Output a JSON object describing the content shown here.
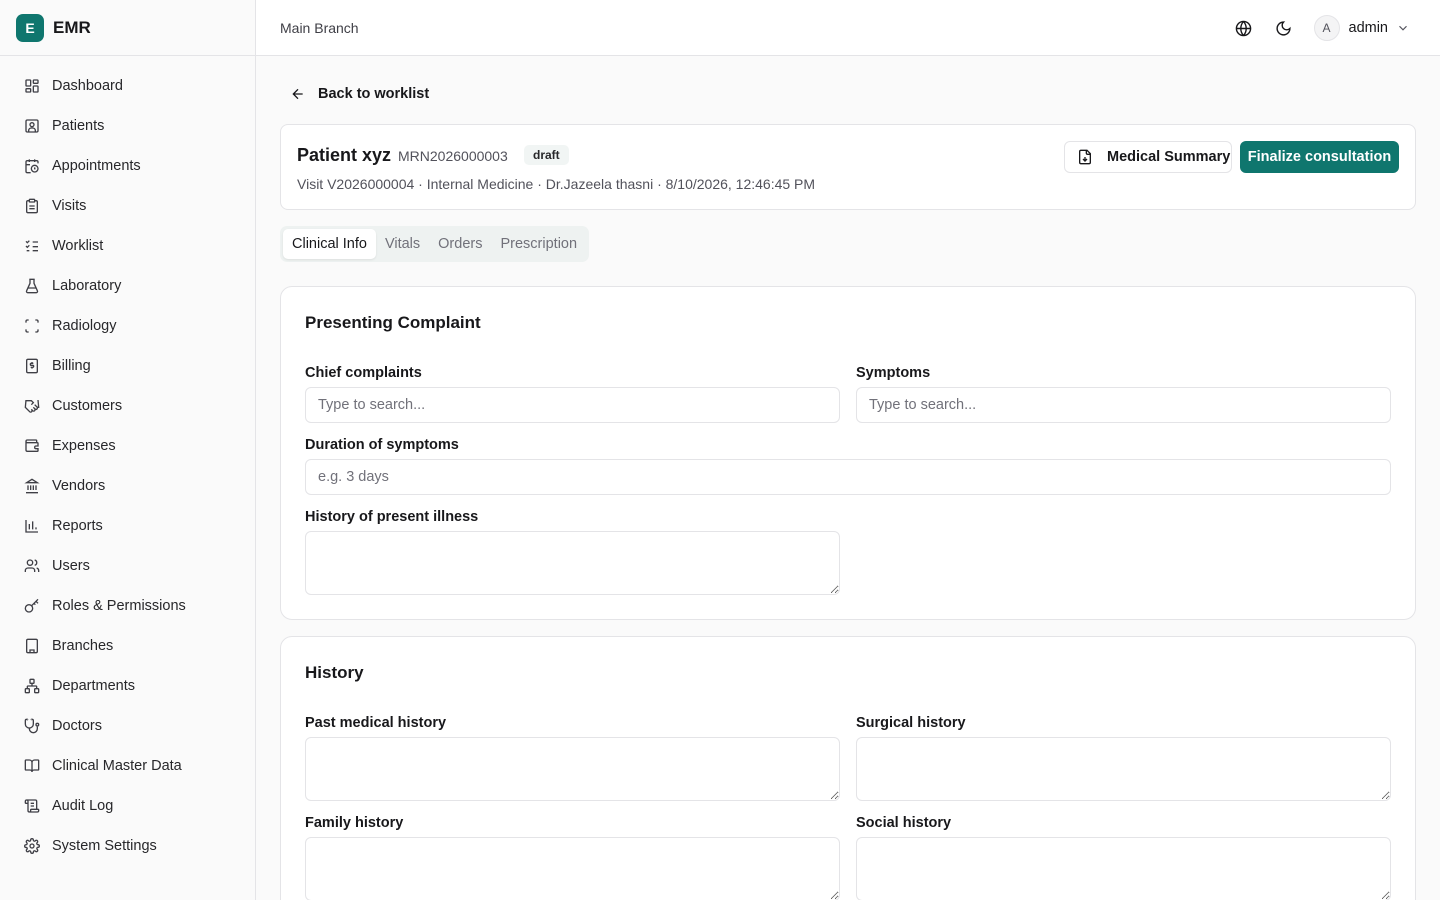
{
  "app": {
    "badge": "E",
    "name": "EMR"
  },
  "sidebar": {
    "items": [
      {
        "label": "Dashboard",
        "icon": "dashboard-icon"
      },
      {
        "label": "Patients",
        "icon": "patient-icon"
      },
      {
        "label": "Appointments",
        "icon": "calendar-clock-icon"
      },
      {
        "label": "Visits",
        "icon": "clipboard-icon"
      },
      {
        "label": "Worklist",
        "icon": "list-checks-icon"
      },
      {
        "label": "Laboratory",
        "icon": "flask-icon"
      },
      {
        "label": "Radiology",
        "icon": "scan-icon"
      },
      {
        "label": "Billing",
        "icon": "receipt-icon"
      },
      {
        "label": "Customers",
        "icon": "handshake-icon"
      },
      {
        "label": "Expenses",
        "icon": "wallet-icon"
      },
      {
        "label": "Vendors",
        "icon": "bank-icon"
      },
      {
        "label": "Reports",
        "icon": "bar-chart-icon"
      },
      {
        "label": "Users",
        "icon": "users-icon"
      },
      {
        "label": "Roles & Permissions",
        "icon": "key-icon"
      },
      {
        "label": "Branches",
        "icon": "building-icon"
      },
      {
        "label": "Departments",
        "icon": "network-icon"
      },
      {
        "label": "Doctors",
        "icon": "stethoscope-icon"
      },
      {
        "label": "Clinical Master Data",
        "icon": "book-icon"
      },
      {
        "label": "Audit Log",
        "icon": "scroll-icon"
      },
      {
        "label": "System Settings",
        "icon": "gear-icon"
      }
    ]
  },
  "header": {
    "branch": "Main Branch",
    "user_initial": "A",
    "user_name": "admin"
  },
  "main": {
    "back_label": "Back to worklist",
    "patient": {
      "name": "Patient xyz",
      "mrn": "MRN2026000003",
      "status": "draft",
      "visit_line": "Visit V2026000004 · Internal Medicine · Dr.Jazeela thasni · 8/10/2026, 12:46:45 PM"
    },
    "medical_summary_label": "Medical Summary",
    "finalize_label": "Finalize consultation",
    "tabs": [
      {
        "label": "Clinical Info",
        "active": true
      },
      {
        "label": "Vitals",
        "active": false
      },
      {
        "label": "Orders",
        "active": false
      },
      {
        "label": "Prescription",
        "active": false
      }
    ],
    "presenting": {
      "title": "Presenting Complaint",
      "chief_label": "Chief complaints",
      "chief_placeholder": "Type to search...",
      "symptoms_label": "Symptoms",
      "symptoms_placeholder": "Type to search...",
      "duration_label": "Duration of symptoms",
      "duration_placeholder": "e.g. 3 days",
      "hpi_label": "History of present illness"
    },
    "history": {
      "title": "History",
      "past_label": "Past medical history",
      "surgical_label": "Surgical history",
      "family_label": "Family history",
      "social_label": "Social history"
    }
  },
  "colors": {
    "accent": "#0f766e",
    "border": "#e4e4e7",
    "background": "#fafafa"
  }
}
